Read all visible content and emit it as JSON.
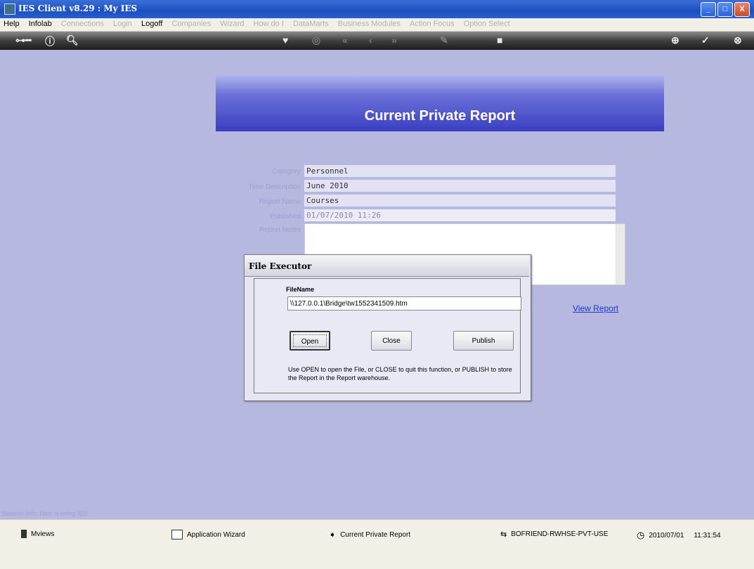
{
  "window": {
    "title": "IES Client v8.29 : My IES",
    "controls": [
      "_",
      "□",
      "X"
    ]
  },
  "menu": {
    "items": [
      {
        "label": "Help",
        "enabled": true
      },
      {
        "label": "Infolab",
        "enabled": true
      },
      {
        "label": "Connections",
        "enabled": false
      },
      {
        "label": "Login",
        "enabled": false
      },
      {
        "label": "Logoff",
        "enabled": true
      },
      {
        "label": "Companies",
        "enabled": false
      },
      {
        "label": "Wizard",
        "enabled": false
      },
      {
        "label": "How do I",
        "enabled": false
      },
      {
        "label": "DataMarts",
        "enabled": false
      },
      {
        "label": "Business Modules",
        "enabled": false
      },
      {
        "label": "Action Focus",
        "enabled": false
      },
      {
        "label": "Option Select",
        "enabled": false
      }
    ]
  },
  "page": {
    "title": "Current Private Report"
  },
  "form": {
    "category_label": "Category",
    "category_value": "Personnel",
    "time_label": "Time Description",
    "time_value": "June 2010",
    "report_name_label": "Report Name",
    "report_name_value": "Courses",
    "published_label": "Published",
    "published_value": "01/07/2010 11:26",
    "notes_label": "Report Notes",
    "notes_value": ""
  },
  "view_report_link": "View Report",
  "dialog": {
    "title": "File Executor",
    "filename_label": "FileName",
    "filename_value": "\\\\127.0.0.1\\Bridge\\tw1552341509.htm",
    "open_label": "Open",
    "close_label": "Close",
    "publish_label": "Publish",
    "help_text": "Use OPEN to open the File, or CLOSE to quit this function, or PUBLISH to store the Report in the Report warehouse."
  },
  "session_text": "Session Info: Nico is using IES",
  "status": {
    "views": "Mviews",
    "wizard": "Application Wizard",
    "current": "Current Private Report",
    "connection": "BOFRIEND-RWHSE-PVT-USE",
    "date": "2010/07/01",
    "time": "11:31:54"
  }
}
